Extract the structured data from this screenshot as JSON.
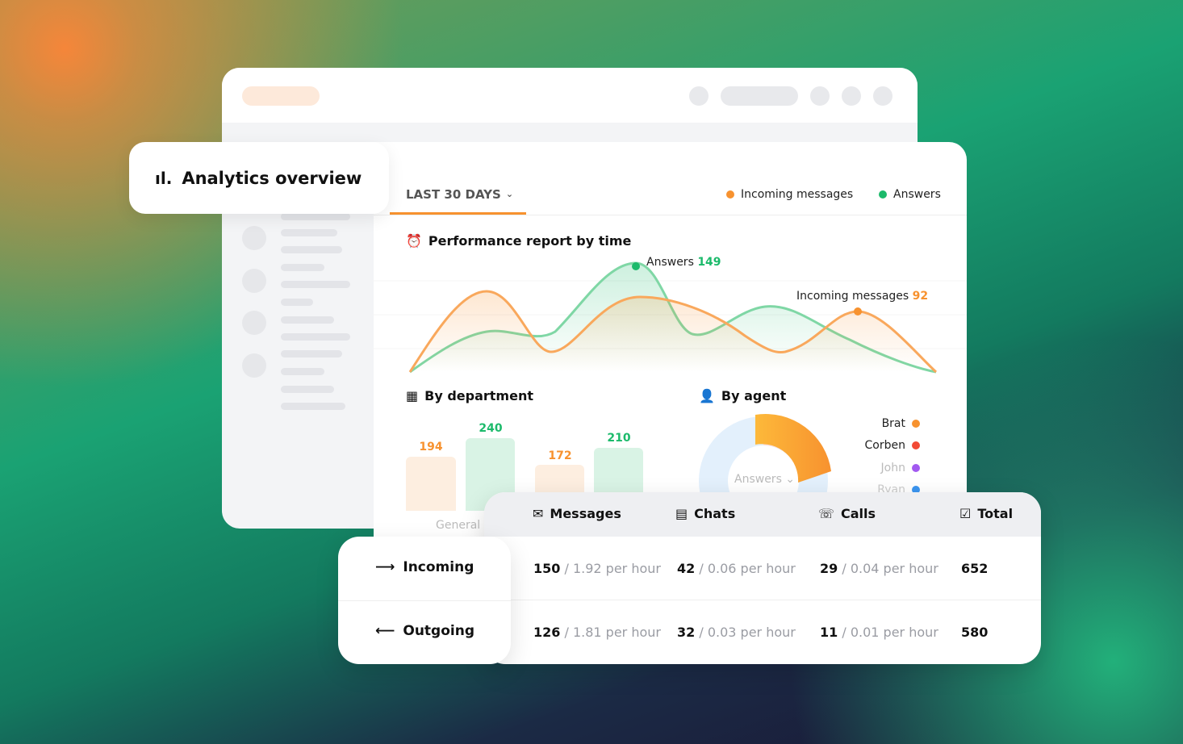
{
  "app": {
    "title": "Analytics overview",
    "period": "LAST 30 DAYS"
  },
  "legend": [
    {
      "label": "Incoming messages",
      "color": "#f7922f"
    },
    {
      "label": "Answers",
      "color": "#1cba6b"
    }
  ],
  "performance": {
    "title": "Performance report by time",
    "answers_label": "Answers",
    "answers_value": "149",
    "incoming_label": "Incoming messages",
    "incoming_value": "92"
  },
  "department": {
    "title": "By department",
    "bars": [
      {
        "value": "194",
        "series": "Incoming messages"
      },
      {
        "value": "240",
        "series": "Answers"
      },
      {
        "value": "172",
        "series": "Incoming messages"
      },
      {
        "value": "210",
        "series": "Answers"
      }
    ],
    "category": "General"
  },
  "agent": {
    "title": "By agent",
    "selector": "Answers",
    "agents": [
      {
        "name": "Brat",
        "color": "#f7922f"
      },
      {
        "name": "Corben",
        "color": "#f24a35"
      },
      {
        "name": "John",
        "color": "#a259f0"
      },
      {
        "name": "Ryan",
        "color": "#3b95f0"
      }
    ]
  },
  "table": {
    "columns": [
      "Messages",
      "Chats",
      "Calls",
      "Total"
    ],
    "rows": [
      {
        "label": "Incoming",
        "messages": "150",
        "messages_rate": "1.92 per hour",
        "chats": "42",
        "chats_rate": "0.06 per hour",
        "calls": "29",
        "calls_rate": "0.04 per hour",
        "total": "652"
      },
      {
        "label": "Outgoing",
        "messages": "126",
        "messages_rate": "1.81 per hour",
        "chats": "32",
        "chats_rate": "0.03 per hour",
        "calls": "11",
        "calls_rate": "0.01 per hour",
        "total": "580"
      }
    ]
  }
}
